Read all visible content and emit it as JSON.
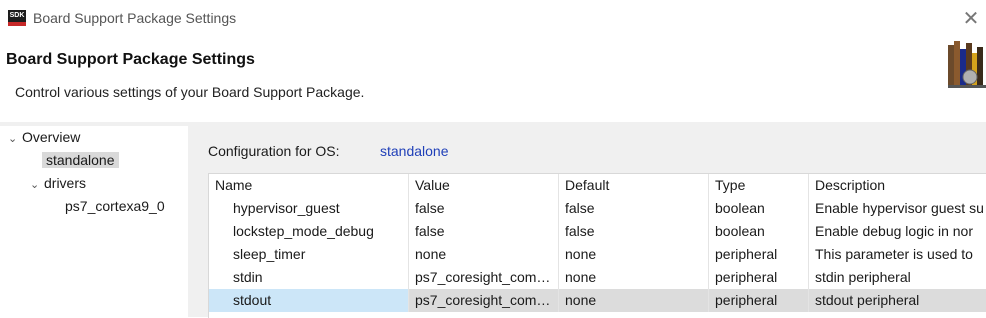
{
  "window": {
    "icon_text": "SDK",
    "title": "Board Support Package Settings",
    "close_icon": "close-icon"
  },
  "header": {
    "title": "Board Support Package Settings",
    "description": "Control various settings of your Board Support Package.",
    "logo_icon": "books-icon"
  },
  "tree": {
    "items": [
      {
        "label": "Overview",
        "expanded": true
      },
      {
        "label": "standalone",
        "selected": true
      },
      {
        "label": "drivers",
        "expanded": true
      },
      {
        "label": "ps7_cortexa9_0"
      }
    ]
  },
  "config": {
    "label": "Configuration for OS:",
    "os_value": "standalone"
  },
  "table": {
    "headers": [
      "Name",
      "Value",
      "Default",
      "Type",
      "Description"
    ],
    "rows": [
      [
        "hypervisor_guest",
        "false",
        "false",
        "boolean",
        "Enable hypervisor guest su"
      ],
      [
        "lockstep_mode_debug",
        "false",
        "false",
        "boolean",
        "Enable debug logic in nor"
      ],
      [
        "sleep_timer",
        "none",
        "none",
        "peripheral",
        "This parameter is used to"
      ],
      [
        "stdin",
        "ps7_coresight_com…",
        "none",
        "peripheral",
        "stdin peripheral"
      ],
      [
        "stdout",
        "ps7_coresight_com…",
        "none",
        "peripheral",
        "stdout peripheral"
      ]
    ],
    "selected_row": 4
  },
  "colors": {
    "link": "#1f3fb8",
    "selection_name": "#cce6f8",
    "selection_row": "#dcdcdc",
    "sdk_red": "#c62828"
  }
}
